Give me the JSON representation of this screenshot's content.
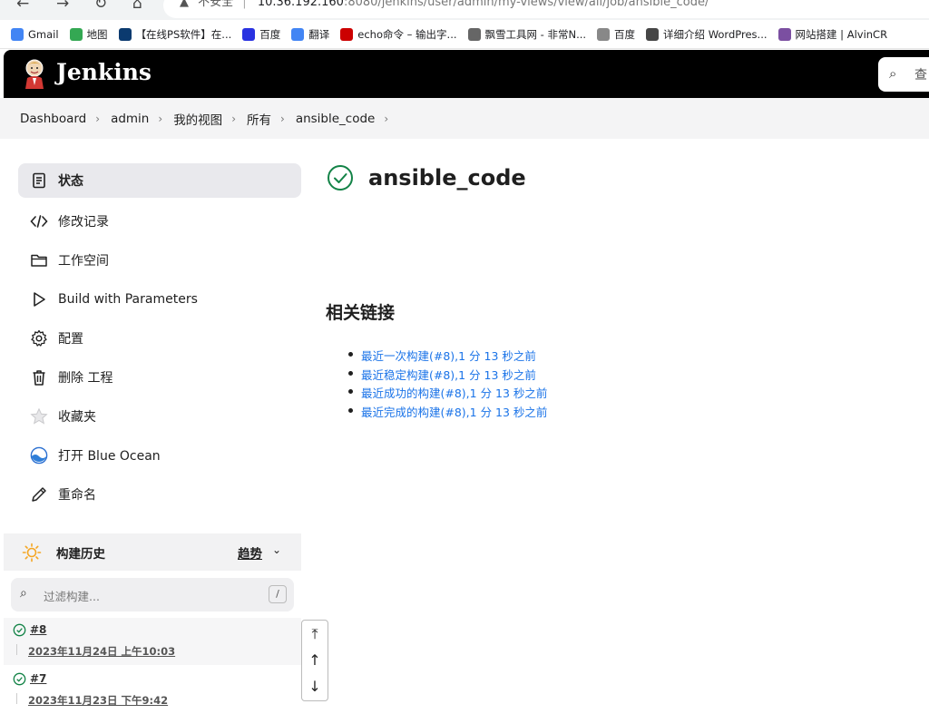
{
  "browser": {
    "insecure_label": "不安全",
    "url_host": "10.36.192.160",
    "url_rest": ":8080/jenkins/user/admin/my-views/view/all/job/ansible_code/",
    "bookmarks": [
      {
        "label": "Gmail",
        "icon": "google-icon",
        "color": "#4285f4"
      },
      {
        "label": "地图",
        "icon": "maps-icon",
        "color": "#34a853"
      },
      {
        "label": "【在线PS软件】在...",
        "icon": "ps-icon",
        "color": "#0b3a6f"
      },
      {
        "label": "百度",
        "icon": "baidu-icon",
        "color": "#2932e1"
      },
      {
        "label": "翻译",
        "icon": "translate-icon",
        "color": "#4285f4"
      },
      {
        "label": "echo命令 – 输出字...",
        "icon": "redhat-icon",
        "color": "#cc0000"
      },
      {
        "label": "飘雪工具网 - 非常N...",
        "icon": "tool-icon",
        "color": "#666666"
      },
      {
        "label": "百度",
        "icon": "page-icon",
        "color": "#888888"
      },
      {
        "label": "详细介绍 WordPres...",
        "icon": "wordpress-icon",
        "color": "#464646"
      },
      {
        "label": "网站搭建 | AlvinCR",
        "icon": "r-icon",
        "color": "#7b4fa1"
      }
    ]
  },
  "header": {
    "title": "Jenkins",
    "search_placeholder": "查"
  },
  "breadcrumb": [
    "Dashboard",
    "admin",
    "我的视图",
    "所有",
    "ansible_code"
  ],
  "sidebar": {
    "items": [
      {
        "label": "状态",
        "icon": "document-icon"
      },
      {
        "label": "修改记录",
        "icon": "code-icon"
      },
      {
        "label": "工作空间",
        "icon": "folder-icon"
      },
      {
        "label": "Build with Parameters",
        "icon": "play-icon"
      },
      {
        "label": "配置",
        "icon": "gear-icon"
      },
      {
        "label": "删除 工程",
        "icon": "trash-icon"
      },
      {
        "label": "收藏夹",
        "icon": "star-icon"
      },
      {
        "label": "打开 Blue Ocean",
        "icon": "blue-ocean-icon"
      },
      {
        "label": "重命名",
        "icon": "pencil-icon"
      }
    ]
  },
  "build_history": {
    "title": "构建历史",
    "trend": "趋势",
    "filter_placeholder": "过滤构建...",
    "shortcut": "/",
    "builds": [
      {
        "number": "#8",
        "date": "2023年11月24日 上午10:03",
        "status": "success"
      },
      {
        "number": "#7",
        "date": "2023年11月23日 下午9:42",
        "status": "success"
      }
    ]
  },
  "main": {
    "job_name": "ansible_code",
    "status": "success",
    "related_title": "相关链接",
    "links": [
      "最近一次构建(#8),1 分 13 秒之前",
      "最近稳定构建(#8),1 分 13 秒之前",
      "最近成功的构建(#8),1 分 13 秒之前",
      "最近完成的构建(#8),1 分 13 秒之前"
    ]
  },
  "colors": {
    "success": "#138347",
    "link": "#1a73e8",
    "header_bg": "#000000"
  }
}
